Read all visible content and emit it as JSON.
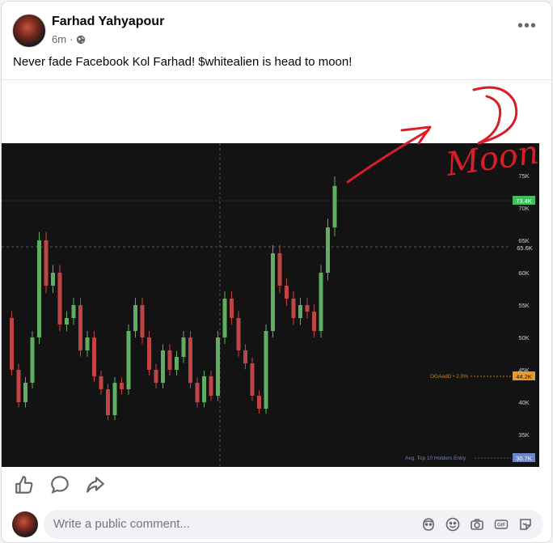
{
  "post": {
    "author": "Farhad Yahyapour",
    "time": "6m",
    "separator": "·",
    "privacy_icon": "globe-icon",
    "text": "Never fade Facebook Kol Farhad! $whitealien is head to moon!"
  },
  "chart_data": {
    "type": "line",
    "ylim": [
      30000,
      80000
    ],
    "y_ticks": [
      "35K",
      "40K",
      "45K",
      "50K",
      "55K",
      "60K",
      "65K",
      "70K",
      "75K"
    ],
    "y": [
      53000,
      45000,
      40000,
      43000,
      50000,
      65000,
      58000,
      60000,
      52000,
      53000,
      55000,
      48000,
      50000,
      44000,
      42000,
      38000,
      43000,
      42000,
      51000,
      55000,
      50000,
      45000,
      43000,
      48000,
      45000,
      47000,
      50000,
      43000,
      40000,
      44000,
      41000,
      50000,
      56000,
      53000,
      48000,
      46000,
      41000,
      39000,
      51000,
      63000,
      58000,
      56000,
      53000,
      55000,
      54000,
      51000,
      60000,
      67000,
      73400
    ],
    "price_labels": [
      "73.4K",
      "65.6K",
      "44.2K",
      "30.7K"
    ],
    "annotations": [
      "OGAedD • 2.0%",
      "Avg. Top 10 Holders Entry"
    ],
    "handwritten": "Moon"
  },
  "actions": {
    "like_icon": "like-icon",
    "comment_icon": "comment-icon",
    "share_icon": "share-icon"
  },
  "comment": {
    "placeholder": "Write a public comment...",
    "icons": [
      "avatar-sticker-icon",
      "emoji-icon",
      "camera-icon",
      "gif-icon",
      "sticker-icon"
    ]
  },
  "colors": {
    "chart_bg": "#131313",
    "up": "#5fae62",
    "down": "#c04444",
    "pen": "#d81e28"
  }
}
